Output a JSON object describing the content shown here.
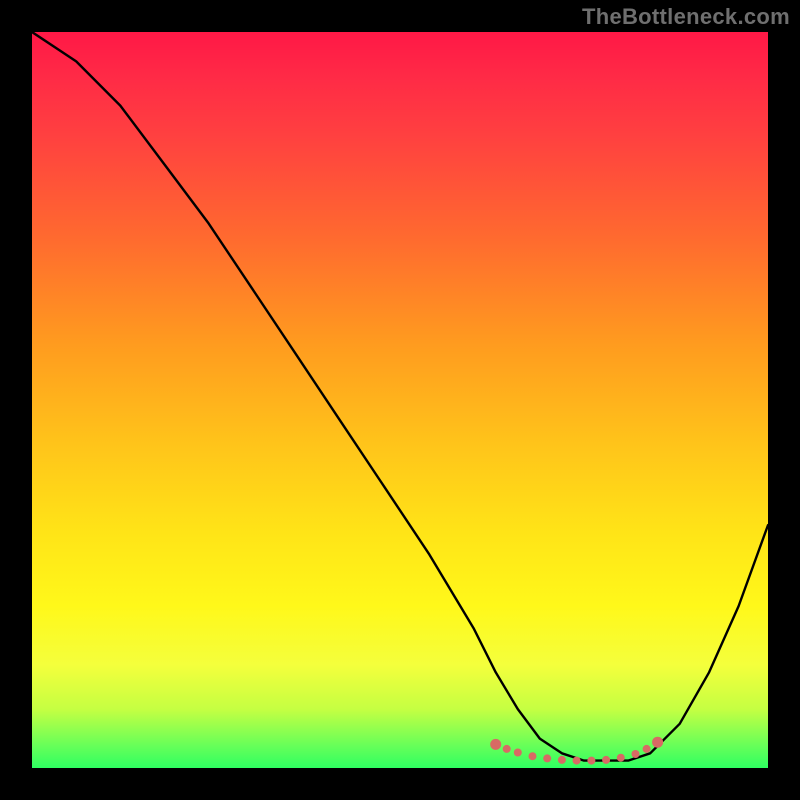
{
  "watermark": "TheBottleneck.com",
  "chart_data": {
    "type": "line",
    "title": "",
    "xlabel": "",
    "ylabel": "",
    "xlim": [
      0,
      100
    ],
    "ylim": [
      0,
      100
    ],
    "series": [
      {
        "name": "bottleneck-curve",
        "x": [
          0,
          6,
          12,
          18,
          24,
          30,
          36,
          42,
          48,
          54,
          60,
          63,
          66,
          69,
          72,
          75,
          78,
          81,
          84,
          88,
          92,
          96,
          100
        ],
        "y": [
          100,
          96,
          90,
          82,
          74,
          65,
          56,
          47,
          38,
          29,
          19,
          13,
          8,
          4,
          2,
          1,
          1,
          1,
          2,
          6,
          13,
          22,
          33
        ]
      }
    ],
    "markers": {
      "name": "flat-region-dots",
      "color": "#d86a64",
      "x": [
        63,
        64.5,
        66,
        68,
        70,
        72,
        74,
        76,
        78,
        80,
        82,
        83.5,
        85
      ],
      "y": [
        3.2,
        2.6,
        2.1,
        1.6,
        1.3,
        1.1,
        1.0,
        1.0,
        1.1,
        1.4,
        1.9,
        2.6,
        3.5
      ]
    },
    "background": {
      "gradient_stops": [
        {
          "pos": 0,
          "color": "#ff1846"
        },
        {
          "pos": 28,
          "color": "#ff6a2f"
        },
        {
          "pos": 56,
          "color": "#ffc41a"
        },
        {
          "pos": 78,
          "color": "#fff81a"
        },
        {
          "pos": 97,
          "color": "#66ff59"
        },
        {
          "pos": 100,
          "color": "#2fff61"
        }
      ]
    }
  }
}
